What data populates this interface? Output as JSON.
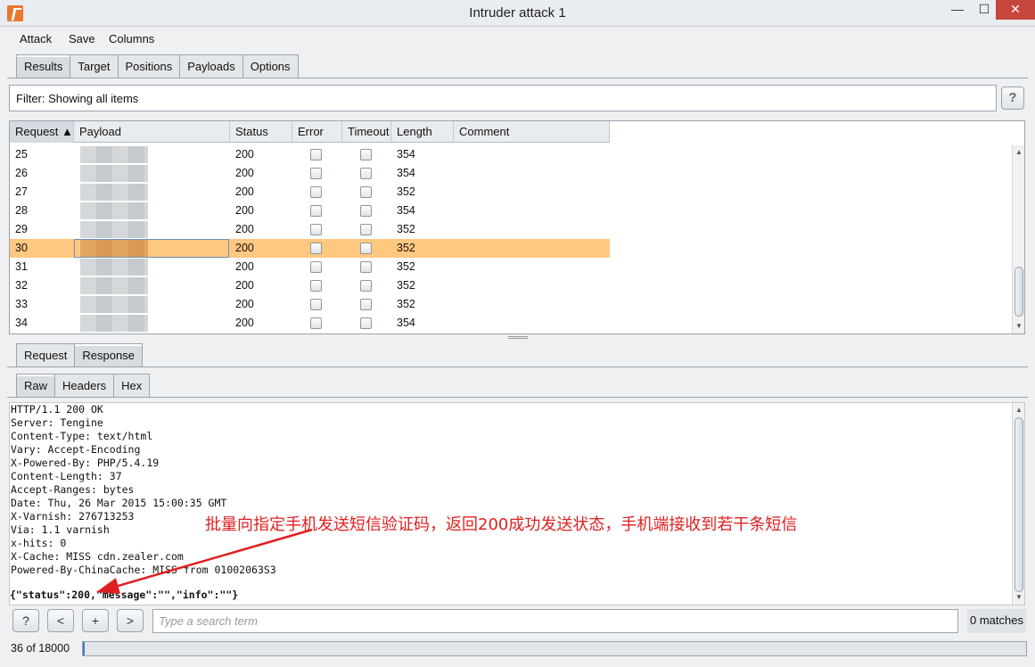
{
  "window": {
    "title": "Intruder attack 1",
    "min": "—",
    "max": "☐",
    "close": "✕"
  },
  "menu": [
    "Attack",
    "Save",
    "Columns"
  ],
  "top_tabs": [
    "Results",
    "Target",
    "Positions",
    "Payloads",
    "Options"
  ],
  "filter": {
    "text": "Filter: Showing all items",
    "help": "?"
  },
  "table": {
    "headers": [
      "Request ▲",
      "Payload",
      "Status",
      "Error",
      "Timeout",
      "Length",
      "Comment"
    ],
    "rows": [
      {
        "request": "25",
        "status": "200",
        "length": "354"
      },
      {
        "request": "26",
        "status": "200",
        "length": "354"
      },
      {
        "request": "27",
        "status": "200",
        "length": "352"
      },
      {
        "request": "28",
        "status": "200",
        "length": "354"
      },
      {
        "request": "29",
        "status": "200",
        "length": "352"
      },
      {
        "request": "30",
        "status": "200",
        "length": "352",
        "selected": true
      },
      {
        "request": "31",
        "status": "200",
        "length": "352"
      },
      {
        "request": "32",
        "status": "200",
        "length": "352"
      },
      {
        "request": "33",
        "status": "200",
        "length": "352"
      },
      {
        "request": "34",
        "status": "200",
        "length": "354"
      }
    ]
  },
  "detail_tabs": [
    "Request",
    "Response"
  ],
  "view_tabs": [
    "Raw",
    "Headers",
    "Hex"
  ],
  "response": {
    "lines": [
      "HTTP/1.1 200 OK",
      "Server: Tengine",
      "Content-Type: text/html",
      "Vary: Accept-Encoding",
      "X-Powered-By: PHP/5.4.19",
      "Content-Length: 37",
      "Accept-Ranges: bytes",
      "Date: Thu, 26 Mar 2015 15:00:35 GMT",
      "X-Varnish: 276713253",
      "Via: 1.1 varnish",
      "x-hits: 0",
      "X-Cache: MISS cdn.zealer.com",
      "Powered-By-ChinaCache: MISS from 01002063S3"
    ],
    "body": "{\"status\":200,\"message\":\"\",\"info\":\"\"}"
  },
  "annotation": "批量向指定手机发送短信验证码，返回200成功发送状态，手机端接收到若干条短信",
  "search": {
    "placeholder": "Type a search term",
    "matches": "0 matches",
    "help": "?",
    "prev": "<",
    "add": "+",
    "next": ">"
  },
  "progress": {
    "text": "36 of 18000",
    "fraction": 0.002
  },
  "colors": {
    "selected_row": "#ffc880",
    "annotation": "#e02020",
    "progress": "#3c7fd4"
  }
}
